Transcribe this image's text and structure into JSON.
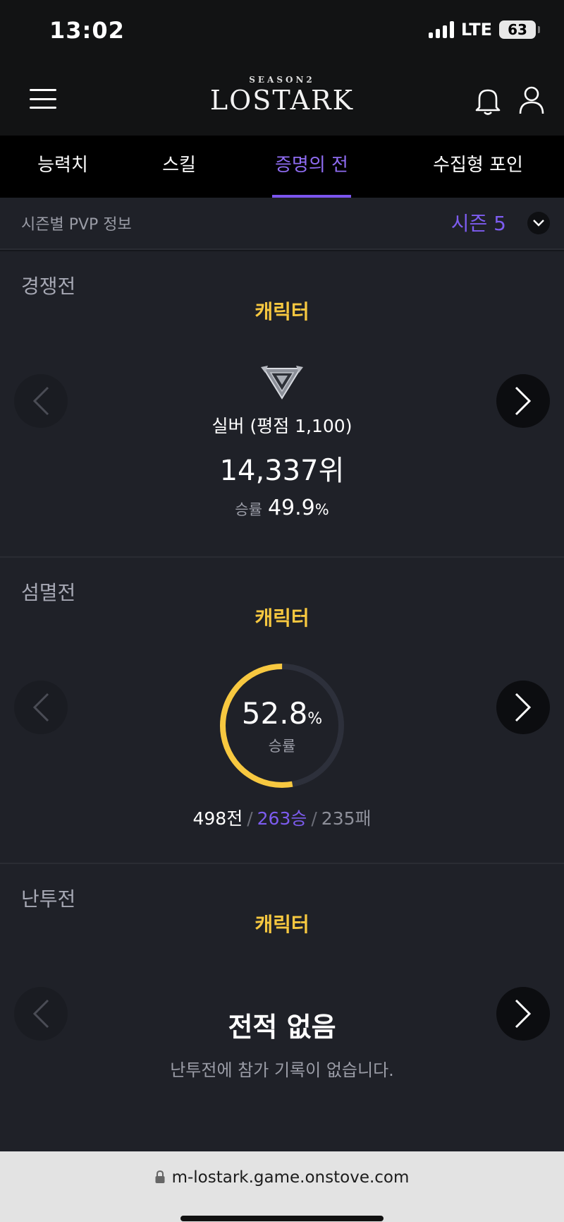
{
  "status": {
    "time": "13:02",
    "network": "LTE",
    "battery": "63"
  },
  "header": {
    "logo_season": "SEASON2",
    "logo_text": "LOSTARK"
  },
  "tabs": [
    {
      "label": "능력치",
      "active": false
    },
    {
      "label": "스킬",
      "active": false
    },
    {
      "label": "증명의 전장",
      "active": true
    },
    {
      "label": "수집형 포인트",
      "active": false
    }
  ],
  "season": {
    "label": "시즌별 PVP 정보",
    "selected": "시즌 5"
  },
  "competitive": {
    "title": "경쟁전",
    "subtitle": "캐릭터",
    "tier": "실버 (평점 1,100)",
    "rank": "14,337위",
    "winrate_label": "승률",
    "winrate_value": "49.9",
    "winrate_unit": "%"
  },
  "annihilation": {
    "title": "섬멸전",
    "subtitle": "캐릭터",
    "winrate_value": "52.8",
    "winrate_unit": "%",
    "winrate_label": "승률",
    "winrate_fraction": 0.528,
    "total": "498전",
    "sep": "/",
    "wins": "263승",
    "losses": "235패"
  },
  "melee": {
    "title": "난투전",
    "subtitle": "캐릭터",
    "empty_title": "전적 없음",
    "empty_desc": "난투전에 참가 기록이 없습니다."
  },
  "browser": {
    "url": "m-lostark.game.onstove.com"
  },
  "colors": {
    "accent": "#7d5cf0",
    "gold": "#f7c840",
    "donut_track": "#2d303b"
  }
}
